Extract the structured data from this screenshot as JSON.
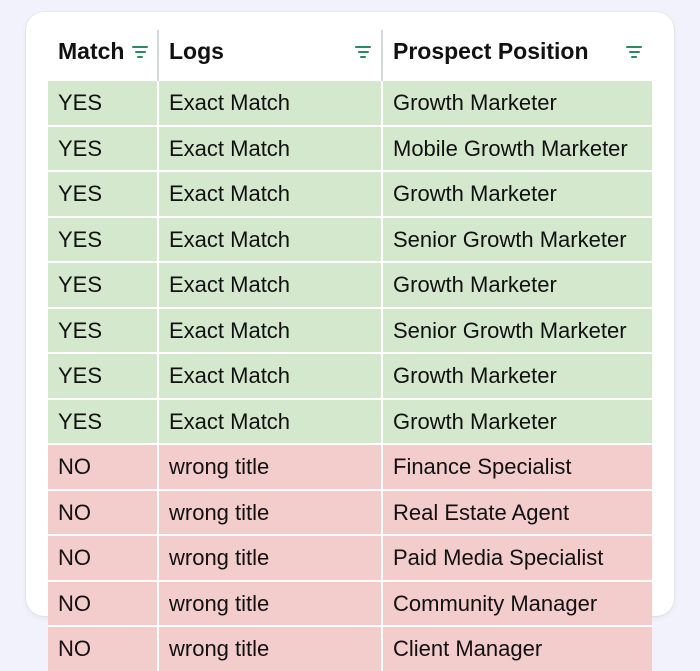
{
  "table": {
    "columns": [
      {
        "key": "match",
        "label": "Match"
      },
      {
        "key": "logs",
        "label": "Logs"
      },
      {
        "key": "position",
        "label": "Prospect Position"
      }
    ],
    "rows": [
      {
        "match": "YES",
        "logs": "Exact Match",
        "position": "Growth Marketer"
      },
      {
        "match": "YES",
        "logs": "Exact Match",
        "position": "Mobile Growth Marketer"
      },
      {
        "match": "YES",
        "logs": "Exact Match",
        "position": "Growth Marketer"
      },
      {
        "match": "YES",
        "logs": "Exact Match",
        "position": "Senior Growth Marketer"
      },
      {
        "match": "YES",
        "logs": "Exact Match",
        "position": "Growth Marketer"
      },
      {
        "match": "YES",
        "logs": "Exact Match",
        "position": "Senior Growth Marketer"
      },
      {
        "match": "YES",
        "logs": "Exact Match",
        "position": "Growth Marketer"
      },
      {
        "match": "YES",
        "logs": "Exact Match",
        "position": "Growth Marketer"
      },
      {
        "match": "NO",
        "logs": "wrong title",
        "position": "Finance Specialist"
      },
      {
        "match": "NO",
        "logs": "wrong title",
        "position": "Real Estate Agent"
      },
      {
        "match": "NO",
        "logs": "wrong title",
        "position": "Paid Media Specialist"
      },
      {
        "match": "NO",
        "logs": "wrong title",
        "position": "Community Manager"
      },
      {
        "match": "NO",
        "logs": "wrong title",
        "position": "Client Manager"
      }
    ]
  },
  "colors": {
    "row_yes_bg": "#d4e8ce",
    "row_no_bg": "#f3cccc",
    "filter_icon": "#2b8a5e"
  }
}
